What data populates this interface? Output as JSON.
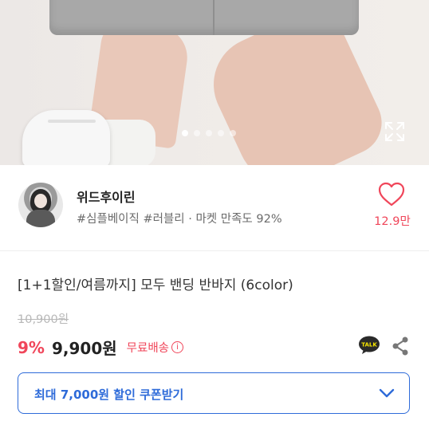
{
  "hero": {
    "image_alt": "",
    "carousel": {
      "total": 5,
      "active_index": 0
    }
  },
  "seller": {
    "name": "위드후이린",
    "tags": "#심플베이직 #러블리 · 마켓 만족도 92%",
    "likes": "12.9만"
  },
  "product": {
    "title": "[1+1할인/여름까지] 모두 밴딩 반바지 (6color)",
    "original_price": "10,900원",
    "discount": "9%",
    "price": "9,900원",
    "shipping": "무료배송",
    "info_glyph": "i"
  },
  "coupon": {
    "label": "최대 7,000원 할인 쿠폰받기"
  },
  "icons": {
    "heart": "heart-icon",
    "expand": "expand-icon",
    "talk": "kakaotalk-icon",
    "share": "share-icon",
    "chevron": "chevron-down-icon"
  },
  "colors": {
    "accent_red": "#f0465a",
    "accent_blue": "#2e6bd9",
    "talk_yellow": "#2a2a2a"
  }
}
